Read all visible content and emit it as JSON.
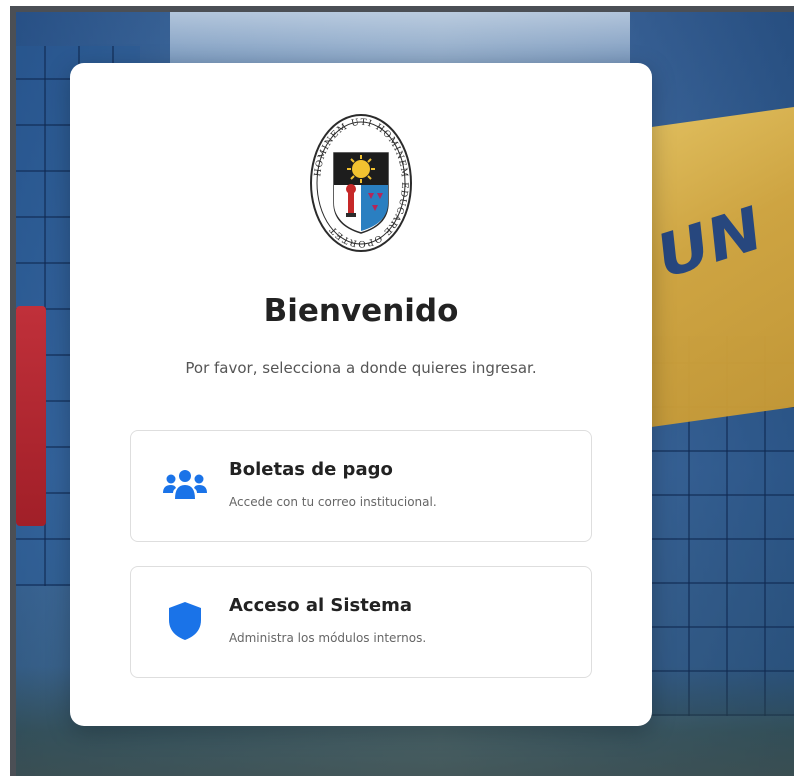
{
  "card": {
    "title": "Bienvenido",
    "subtitle": "Por favor, selecciona a donde quieres ingresar."
  },
  "logo": {
    "icon": "university-seal-icon",
    "motto": "HOMINEM UTI HOMINEM EDUCARE OPORTET"
  },
  "options": [
    {
      "title": "Boletas de pago",
      "description": "Accede con tu correo institucional.",
      "icon": "users-icon"
    },
    {
      "title": "Acceso al Sistema",
      "description": "Administra los módulos internos.",
      "icon": "shield-icon"
    }
  ],
  "background": {
    "flag_text": "UN"
  },
  "colors": {
    "accent": "#1a73e8",
    "title": "#222222",
    "card_bg": "#ffffff"
  }
}
